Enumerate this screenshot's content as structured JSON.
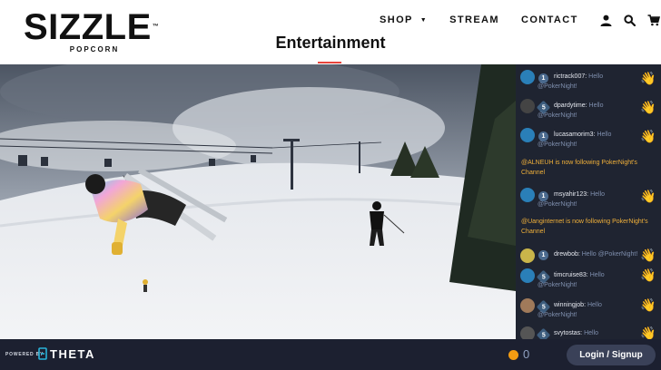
{
  "brand": {
    "name": "SIZZLE",
    "tm": "™",
    "sub": "POPCORN"
  },
  "nav": {
    "shop": "SHOP",
    "stream": "STREAM",
    "contact": "CONTACT"
  },
  "page": {
    "title": "Entertainment"
  },
  "chat": {
    "messages": [
      {
        "user": "rictrack007:",
        "text": "Hello @PokerNight!",
        "badge": "1",
        "avatar_color": "#2a7fb8"
      },
      {
        "user": "dpardytime:",
        "text": "Hello @PokerNight!",
        "badge": "5",
        "avatar_color": "#444444"
      },
      {
        "user": "lucasamorim3:",
        "text": "Hello @PokerNight!",
        "badge": "1",
        "avatar_color": "#2a7fb8"
      },
      {
        "system": "@ALNEUH is now following PokerNight's Channel"
      },
      {
        "user": "msyahir123:",
        "text": "Hello @PokerNight!",
        "badge": "1",
        "avatar_color": "#2a7fb8"
      },
      {
        "system": "@Uanginternet is now following PokerNight's Channel"
      },
      {
        "user": "drewbob:",
        "text": "Hello @PokerNight!",
        "badge": "1",
        "avatar_color": "#c9b54a"
      },
      {
        "user": "timcruise83:",
        "text": "Hello @PokerNight!",
        "badge": "5",
        "avatar_color": "#2a7fb8"
      },
      {
        "user": "winningjob:",
        "text": "Hello @PokerNight!",
        "badge": "5",
        "avatar_color": "#a07a5a"
      },
      {
        "user": "svytostas:",
        "text": "Hello",
        "badge": "5",
        "avatar_color": "#555555"
      }
    ]
  },
  "footer": {
    "powered_by": "POWERED BY",
    "theta": "THETA",
    "coins": "0",
    "login": "Login / Signup"
  },
  "colors": {
    "accent": "#e8453c",
    "chat_bg": "#1f2431",
    "system_text": "#f0b03a",
    "footer_bg": "#1c2030"
  }
}
